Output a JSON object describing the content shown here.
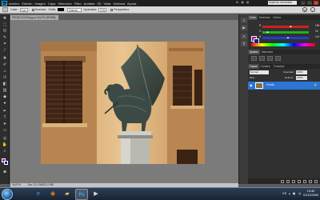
{
  "menubar": {
    "logo": "Ps",
    "items": [
      "Archivo",
      "Edición",
      "Imagen",
      "Capa",
      "Selección",
      "Filtro",
      "Análisis",
      "3D",
      "Vista",
      "Ventana",
      "Ayuda"
    ],
    "workspace_label": "Aspectos esenciales"
  },
  "options": {
    "feather_label": "Calar:",
    "feather_value": "0 px",
    "antialias_label": "Suavizar",
    "style_label": "Estilo:",
    "style_value": "Normal",
    "opacity_label": "Opacidad:",
    "opacity_value": "70%",
    "perspective_label": "Perspectiva"
  },
  "document": {
    "tab_title": "PRODUCCIÓN.jpg al 16,67% (RGB/8)",
    "zoom": "16,67%",
    "status": "Doc: 21,0 MB/21,0 MB"
  },
  "panels": {
    "color_tabs": [
      "Color",
      "Muestras",
      "Estilos"
    ],
    "sliders": [
      {
        "label": "R",
        "value": "156",
        "color": "#d02020",
        "level": 0.61
      },
      {
        "label": "G",
        "value": "28",
        "color": "#20b020",
        "level": 0.11
      },
      {
        "label": "B",
        "value": "141",
        "color": "#2040d0",
        "level": 0.55
      }
    ],
    "adjust_tabs": [
      "Ajustes",
      "Máscaras"
    ],
    "layers_tabs": [
      "Capas",
      "Canales",
      "Trazados"
    ],
    "blend_mode": "Normal",
    "opacity_label": "Opacidad:",
    "opacity_value": "100%",
    "lock_label": "Bloq.:",
    "fill_label": "Relleno:",
    "fill_value": "100%",
    "layer_name": "Fondo"
  },
  "taskbar": {
    "language": "ES",
    "time": "13:40",
    "date": "01/12/2009"
  },
  "colors": {
    "foreground": "#9c1c8d",
    "background": "#1c1c9c",
    "accent": "#2b75d4"
  }
}
